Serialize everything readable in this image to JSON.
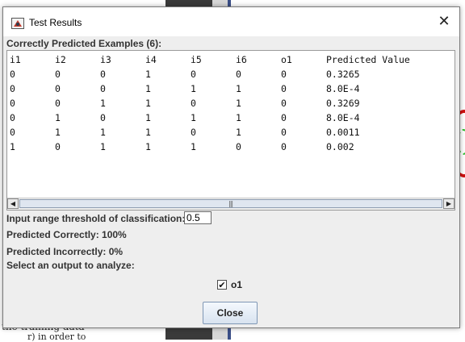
{
  "dialog": {
    "title": "Test Results",
    "close_glyph": "✕",
    "section_label": "Correctly Predicted Examples (6):",
    "table": {
      "headers": [
        "i1",
        "i2",
        "i3",
        "i4",
        "i5",
        "i6",
        "o1",
        "Predicted Value"
      ],
      "rows": [
        [
          "0",
          "0",
          "0",
          "1",
          "0",
          "0",
          "0",
          "0.3265"
        ],
        [
          "0",
          "0",
          "0",
          "1",
          "1",
          "1",
          "0",
          "8.0E-4"
        ],
        [
          "0",
          "0",
          "1",
          "1",
          "0",
          "1",
          "0",
          "0.3269"
        ],
        [
          "0",
          "1",
          "0",
          "1",
          "1",
          "1",
          "0",
          "8.0E-4"
        ],
        [
          "0",
          "1",
          "1",
          "1",
          "0",
          "1",
          "0",
          "0.0011"
        ],
        [
          "1",
          "0",
          "1",
          "1",
          "1",
          "0",
          "0",
          "0.002"
        ]
      ]
    },
    "threshold_label": "Input range threshold of classification:",
    "threshold_value": "0.5",
    "predicted_correctly": "Predicted Correctly: 100%",
    "predicted_incorrectly": "Predicted Incorrectly: 0%",
    "select_output_label": "Select an output to analyze:",
    "output_checkbox": {
      "label": "o1",
      "checked": true
    },
    "close_button_label": "Close"
  },
  "background": {
    "doc_text": "the training data",
    "doc_text_2": "r) in order to"
  },
  "icons": {
    "title_icon": "java-app-icon",
    "scroll_left": "◀",
    "scroll_right": "▶",
    "checkmark": "✔"
  }
}
